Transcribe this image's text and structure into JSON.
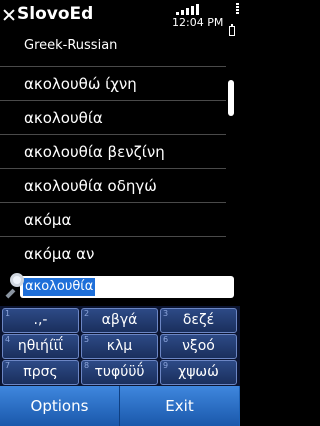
{
  "app": {
    "title": "SlovoEd"
  },
  "status": {
    "time": "12:04 PM"
  },
  "dictionary": "Greek-Russian",
  "words": [
    "ακολουθώ ίχνη",
    "ακολουθία",
    "ακολουθία βενζίνη",
    "ακολουθία οδηγώ",
    "ακόμα",
    "ακόμα αν"
  ],
  "search": {
    "value": "ακολουθία"
  },
  "keypad": [
    {
      "num": "1",
      "label": ".,-"
    },
    {
      "num": "2",
      "label": "αβγά"
    },
    {
      "num": "3",
      "label": "δεζέ"
    },
    {
      "num": "4",
      "label": "ηθιήίϊΐ"
    },
    {
      "num": "5",
      "label": "κλμ"
    },
    {
      "num": "6",
      "label": "νξοό"
    },
    {
      "num": "7",
      "label": "πρσς"
    },
    {
      "num": "8",
      "label": "τυφύϋΰ"
    },
    {
      "num": "9",
      "label": "χψωώ"
    }
  ],
  "softkeys": {
    "left": "Options",
    "right": "Exit"
  },
  "colors": {
    "accent": "#1e6fd9",
    "softkey": "#2a74cf",
    "keypad": "#1f3a73"
  },
  "icons": [
    "close-icon",
    "signal-icon",
    "battery-icon",
    "search-icon"
  ]
}
